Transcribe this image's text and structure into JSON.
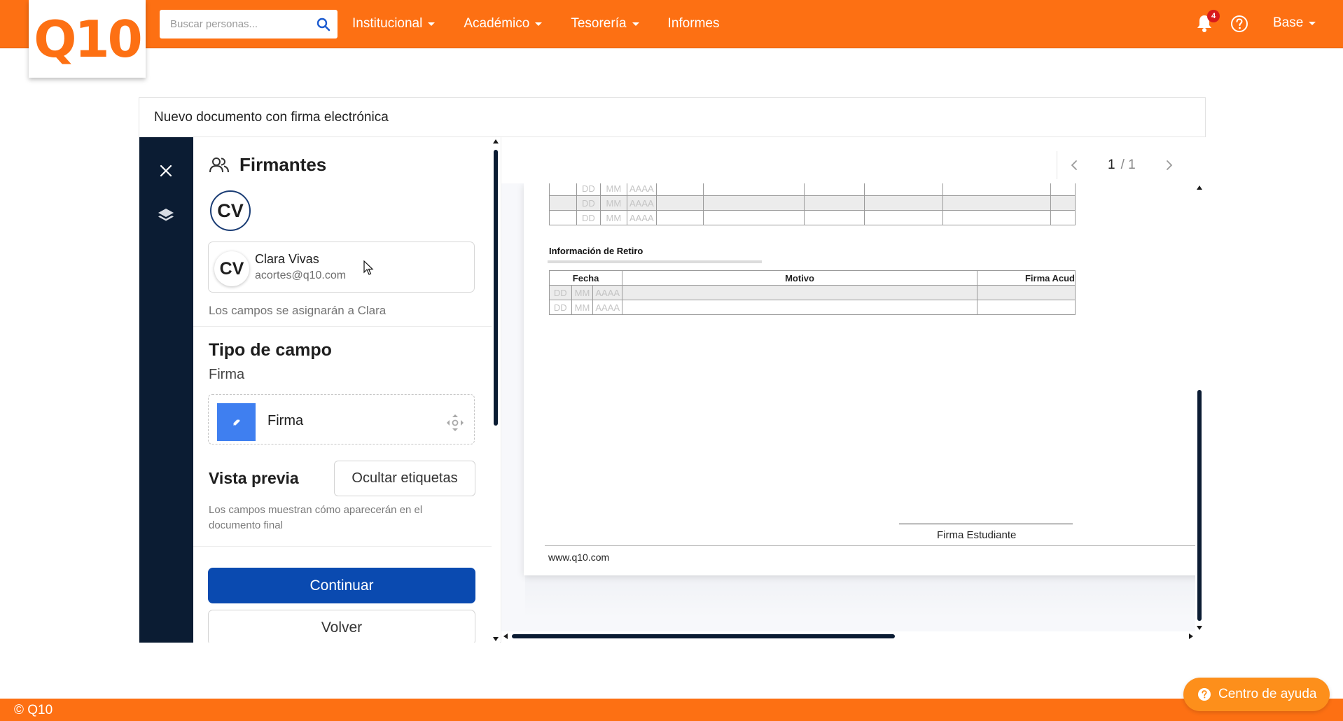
{
  "brand": {
    "logo": "Q10",
    "accent": "#fd7013",
    "dark": "#0b1c33",
    "primary": "#0a4ab0"
  },
  "search": {
    "placeholder": "Buscar personas..."
  },
  "nav": {
    "items": [
      {
        "label": "Institucional",
        "dropdown": true
      },
      {
        "label": "Académico",
        "dropdown": true
      },
      {
        "label": "Tesorería",
        "dropdown": true
      },
      {
        "label": "Informes",
        "dropdown": false
      }
    ],
    "notifications": "4",
    "user": "Base"
  },
  "card": {
    "title": "Nuevo documento con firma electrónica"
  },
  "signers": {
    "title": "Firmantes",
    "initials": "CV",
    "name": "Clara Vivas",
    "email": "acortes@q10.com",
    "note": "Los campos se asignarán a Clara"
  },
  "field_type": {
    "title": "Tipo de campo",
    "subtitle": "Firma",
    "field_label": "Firma"
  },
  "preview": {
    "title": "Vista previa",
    "toggle_label": "Ocultar etiquetas",
    "note": "Los campos muestran cómo aparecerán en el documento final"
  },
  "actions": {
    "continue": "Continuar",
    "back": "Volver"
  },
  "pager": {
    "current": "1",
    "total": "/ 1"
  },
  "document": {
    "date_placeholders": {
      "day": "DD",
      "month": "MM",
      "year": "AAAA"
    },
    "retiro_title": "Información de Retiro",
    "columns": [
      "Fecha",
      "Motivo",
      "Firma Acud"
    ],
    "signature_label": "Firma Estudiante",
    "url": "www.q10.com"
  },
  "footer": {
    "copyright": "© Q10",
    "help_center": "Centro de ayuda"
  }
}
